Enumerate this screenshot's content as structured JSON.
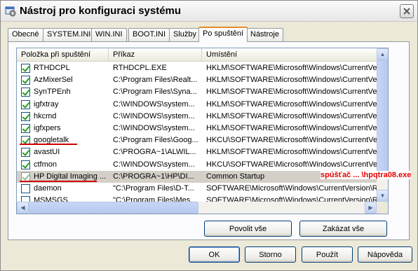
{
  "window": {
    "title": "Nástroj pro konfiguraci systému"
  },
  "tabs": [
    {
      "label": "Obecné",
      "active": false
    },
    {
      "label": "SYSTEM.INI",
      "active": false
    },
    {
      "label": "WIN.INI",
      "active": false
    },
    {
      "label": "BOOT.INI",
      "active": false
    },
    {
      "label": "Služby",
      "active": false
    },
    {
      "label": "Po spuštění",
      "active": true
    },
    {
      "label": "Nástroje",
      "active": false
    }
  ],
  "list": {
    "columns": [
      "Položka při spuštění",
      "Příkaz",
      "Umístění"
    ],
    "rows": [
      {
        "checked": true,
        "item": "RTHDCPL",
        "command": "RTHDCPL.EXE",
        "location": "HKLM\\SOFTWARE\\Microsoft\\Windows\\CurrentVer..."
      },
      {
        "checked": true,
        "item": "AzMixerSel",
        "command": "C:\\Program Files\\Realt...",
        "location": "HKLM\\SOFTWARE\\Microsoft\\Windows\\CurrentVer..."
      },
      {
        "checked": true,
        "item": "SynTPEnh",
        "command": "C:\\Program Files\\Syna...",
        "location": "HKLM\\SOFTWARE\\Microsoft\\Windows\\CurrentVer..."
      },
      {
        "checked": true,
        "item": "igfxtray",
        "command": "C:\\WINDOWS\\system...",
        "location": "HKLM\\SOFTWARE\\Microsoft\\Windows\\CurrentVer..."
      },
      {
        "checked": true,
        "item": "hkcmd",
        "command": "C:\\WINDOWS\\system...",
        "location": "HKLM\\SOFTWARE\\Microsoft\\Windows\\CurrentVer..."
      },
      {
        "checked": true,
        "item": "igfxpers",
        "command": "C:\\WINDOWS\\system...",
        "location": "HKLM\\SOFTWARE\\Microsoft\\Windows\\CurrentVer..."
      },
      {
        "checked": true,
        "item": "googletalk",
        "command": "C:\\Program Files\\Goog...",
        "location": "HKCU\\SOFTWARE\\Microsoft\\Windows\\CurrentVer..."
      },
      {
        "checked": true,
        "item": "avastUI",
        "command": "C:\\PROGRA~1\\ALWIL...",
        "location": "HKLM\\SOFTWARE\\Microsoft\\Windows\\CurrentVer..."
      },
      {
        "checked": true,
        "item": "ctfmon",
        "command": "C:\\WINDOWS\\system...",
        "location": "HKCU\\SOFTWARE\\Microsoft\\Windows\\CurrentVer..."
      },
      {
        "checked": true,
        "item": "HP Digital Imaging ...",
        "command": "C:\\PROGRA~1\\HP\\DI...",
        "location": "Common Startup",
        "selected": true
      },
      {
        "checked": false,
        "item": "daemon",
        "command": "\"C:\\Program Files\\D-T...",
        "location": "SOFTWARE\\Microsoft\\Windows\\CurrentVersion\\Ru..."
      },
      {
        "checked": false,
        "item": "MSMSGS",
        "command": "\"C:\\Program Files\\Mes...",
        "location": "SOFTWARE\\Microsoft\\Windows\\CurrentVersion\\Ru..."
      }
    ]
  },
  "annotation": "spúšťač ... \\hpqtra08.exe",
  "buttons": {
    "enable_all": "Povolit vše",
    "disable_all": "Zakázat vše",
    "ok": "OK",
    "cancel": "Storno",
    "apply": "Použít",
    "help": "Nápověda"
  },
  "colors": {
    "annotation": "#e60000",
    "selected_row": "#d4d0c8",
    "checkmark": "#21a121"
  }
}
